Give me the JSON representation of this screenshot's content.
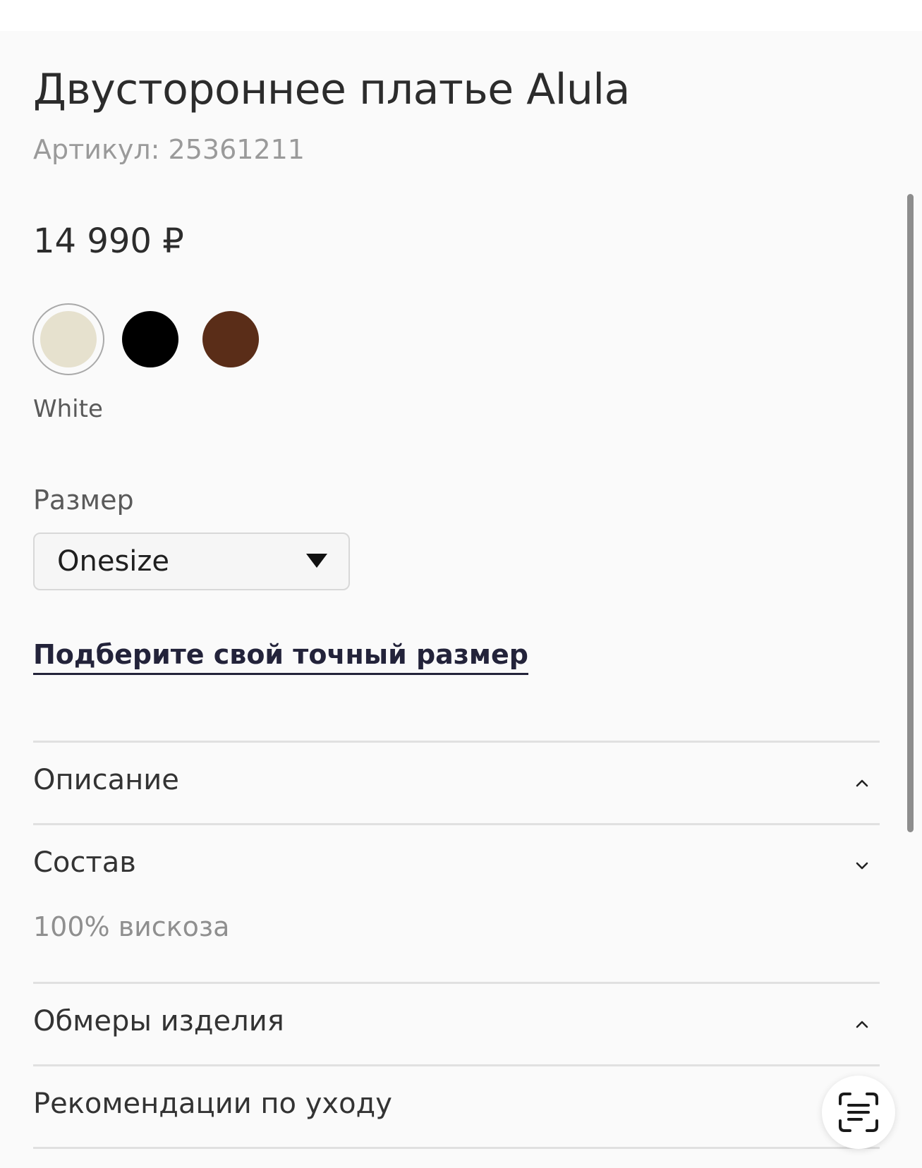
{
  "product": {
    "title": "Двустороннее платье Alula",
    "sku": "Артикул: 25361211",
    "price": "14 990 ₽"
  },
  "colors": {
    "options": [
      {
        "name": "White",
        "hex": "#e6e1ce",
        "selected": true
      },
      {
        "name": "black",
        "hex": "#000000",
        "selected": false
      },
      {
        "name": "brown",
        "hex": "#5a2d18",
        "selected": false
      }
    ],
    "selected_label": "White"
  },
  "size": {
    "label": "Размер",
    "selected_value": "Onesize"
  },
  "fit_link": "Подберите свой точный размер",
  "accordion": [
    {
      "label": "Описание",
      "chevron": "chevron-up-icon"
    },
    {
      "label": "Состав",
      "chevron": "chevron-down-icon",
      "body": "100% вискоза"
    },
    {
      "label": "Обмеры изделия",
      "chevron": "chevron-up-icon"
    },
    {
      "label": "Рекомендации по уходу"
    }
  ],
  "floating_button": {
    "icon": "scan-text-icon"
  }
}
